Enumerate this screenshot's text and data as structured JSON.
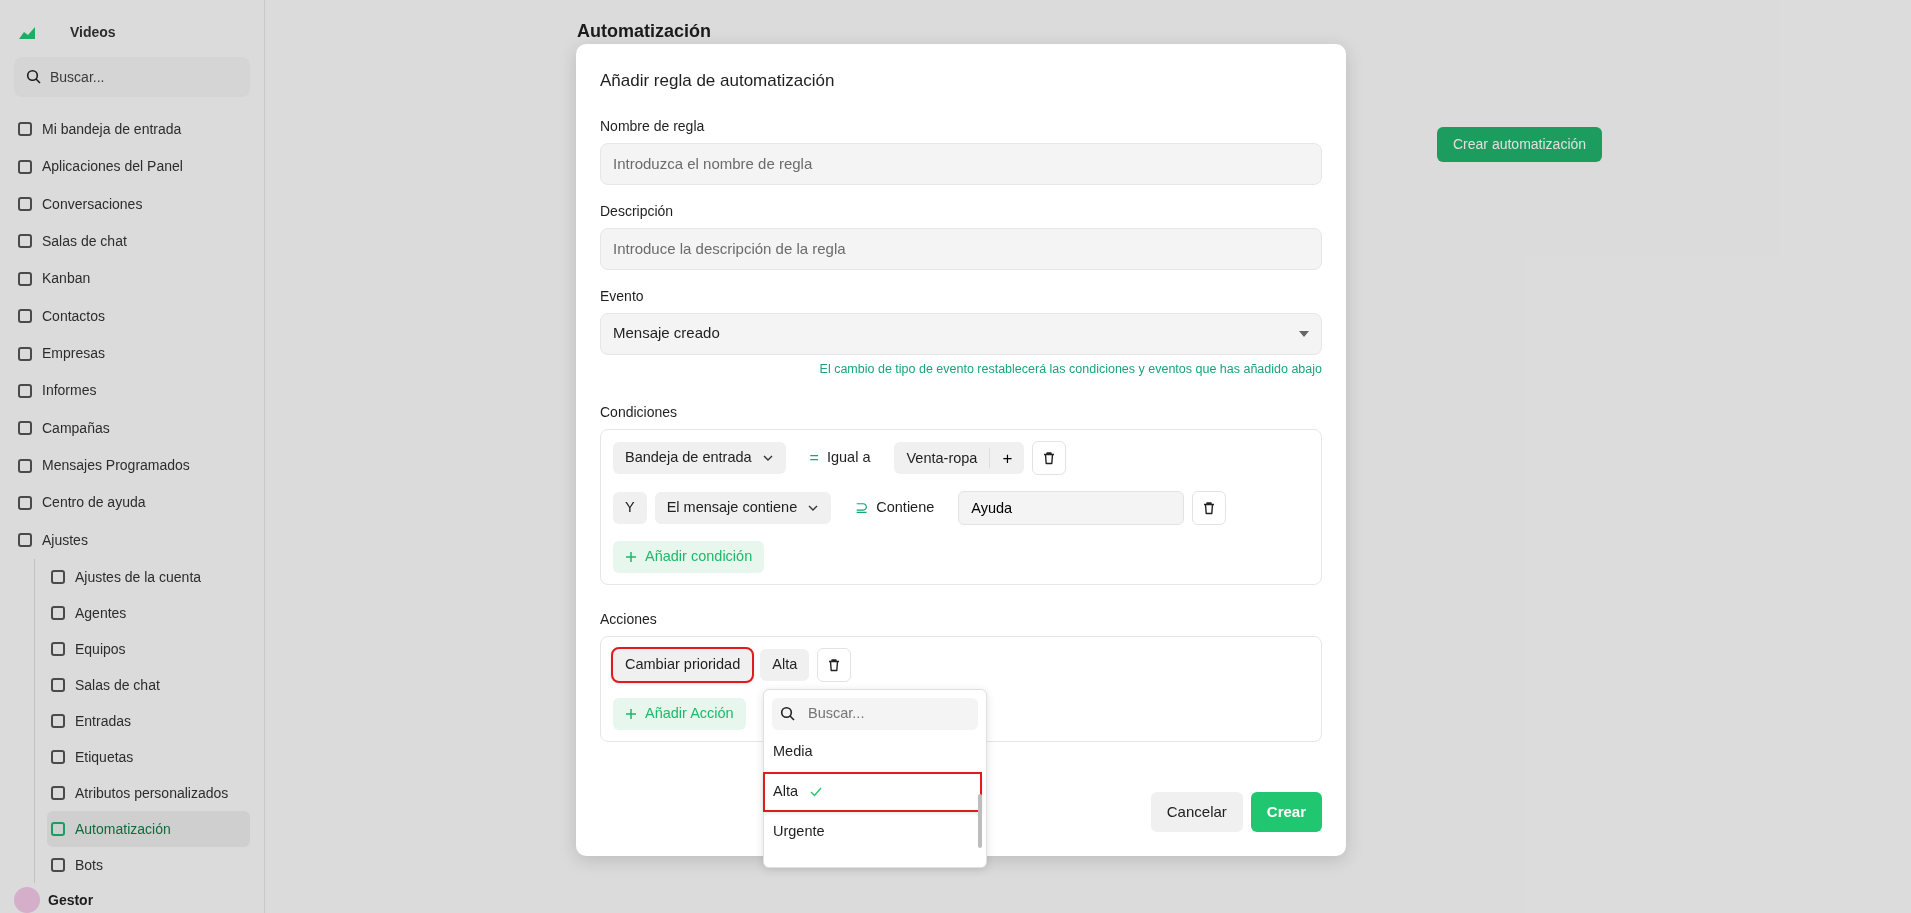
{
  "sidebar": {
    "brand": "Videos",
    "search": {
      "placeholder": "Buscar..."
    },
    "items": [
      {
        "label": "Mi bandeja de entrada",
        "selected": false
      },
      {
        "label": "Aplicaciones del Panel",
        "selected": false
      },
      {
        "label": "Conversaciones",
        "selected": false
      },
      {
        "label": "Salas de chat",
        "selected": false
      },
      {
        "label": "Kanban",
        "selected": false
      },
      {
        "label": "Contactos",
        "selected": false
      },
      {
        "label": "Empresas",
        "selected": false
      },
      {
        "label": "Informes",
        "selected": false
      },
      {
        "label": "Campañas",
        "selected": false
      },
      {
        "label": "Mensajes Programados",
        "selected": false
      },
      {
        "label": "Centro de ayuda",
        "selected": false
      },
      {
        "label": "Ajustes",
        "selected": false,
        "children": [
          {
            "label": "Ajustes de la cuenta",
            "selected": false
          },
          {
            "label": "Agentes",
            "selected": false
          },
          {
            "label": "Equipos",
            "selected": false
          },
          {
            "label": "Salas de chat",
            "selected": false
          },
          {
            "label": "Entradas",
            "selected": false
          },
          {
            "label": "Etiquetas",
            "selected": false
          },
          {
            "label": "Atributos personalizados",
            "selected": false
          },
          {
            "label": "Automatización",
            "selected": true
          },
          {
            "label": "Bots",
            "selected": false
          }
        ]
      }
    ],
    "user": {
      "name": "Gestor"
    }
  },
  "page": {
    "title": "Automatización",
    "create_button": "Crear automatización"
  },
  "modal": {
    "title": "Añadir regla de automatización",
    "fields": [
      {
        "kind": "text",
        "label": "Nombre de regla",
        "placeholder": "Introduzca el nombre de regla"
      },
      {
        "kind": "text",
        "label": "Descripción",
        "placeholder": "Introduce la descripción de la regla"
      },
      {
        "kind": "select",
        "label": "Evento",
        "value": "Mensaje creado",
        "hint": "El cambio de tipo de evento restablecerá las condiciones y eventos que has añadido abajo"
      }
    ],
    "conditions": {
      "label": "Condiciones",
      "rows": [
        {
          "attribute": "Bandeja de entrada",
          "operator_symbol": "=",
          "operator": "Igual a",
          "kind": "tag",
          "value": "Venta-ropa",
          "add_symbol": "+"
        },
        {
          "connector": "Y",
          "attribute": "El mensaje contiene",
          "operator_symbol": "⊇",
          "operator": "Contiene",
          "kind": "input",
          "value": "Ayuda"
        }
      ],
      "add_button": "Añadir condición"
    },
    "actions": {
      "label": "Acciones",
      "rows": [
        {
          "action": "Cambiar prioridad",
          "highlighted": true,
          "value": "Alta"
        }
      ],
      "add_button": "Añadir Acción"
    },
    "dropdown": {
      "search_placeholder": "Buscar...",
      "options": [
        {
          "label": "Media",
          "selected": false,
          "highlighted": false
        },
        {
          "label": "Alta",
          "selected": true,
          "highlighted": true
        },
        {
          "label": "Urgente",
          "selected": false,
          "highlighted": false
        }
      ]
    },
    "buttons": [
      {
        "kind": "secondary",
        "label": "Cancelar"
      },
      {
        "kind": "primary",
        "label": "Crear"
      }
    ]
  }
}
